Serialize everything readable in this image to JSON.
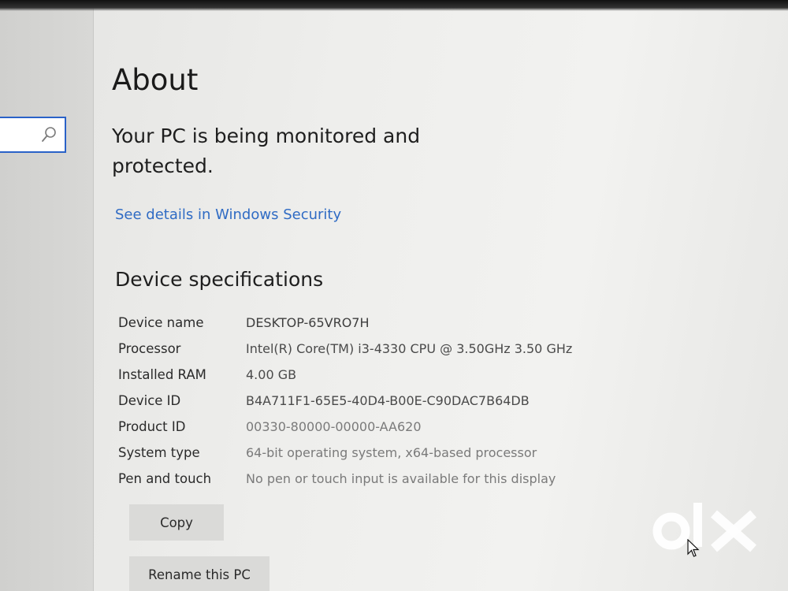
{
  "page": {
    "title": "About"
  },
  "search": {
    "icon": "search-icon"
  },
  "status": {
    "message": "Your PC is being monitored and protected.",
    "link_label": "See details in Windows Security"
  },
  "specs": {
    "heading": "Device specifications",
    "rows": [
      {
        "label": "Device name",
        "value": "DESKTOP-65VRO7H"
      },
      {
        "label": "Processor",
        "value": "Intel(R) Core(TM) i3-4330 CPU @ 3.50GHz   3.50 GHz"
      },
      {
        "label": "Installed RAM",
        "value": "4.00 GB"
      },
      {
        "label": "Device ID",
        "value": "B4A711F1-65E5-40D4-B00E-C90DAC7B64DB"
      },
      {
        "label": "Product ID",
        "value": "00330-80000-00000-AA620"
      },
      {
        "label": "System type",
        "value": "64-bit operating system, x64-based processor"
      },
      {
        "label": "Pen and touch",
        "value": "No pen or touch input is available for this display"
      }
    ]
  },
  "actions": {
    "copy_label": "Copy",
    "rename_label": "Rename this PC"
  },
  "watermark": {
    "text": "olx"
  },
  "colors": {
    "link": "#2f6bc4",
    "search_border": "#2a62c8"
  }
}
